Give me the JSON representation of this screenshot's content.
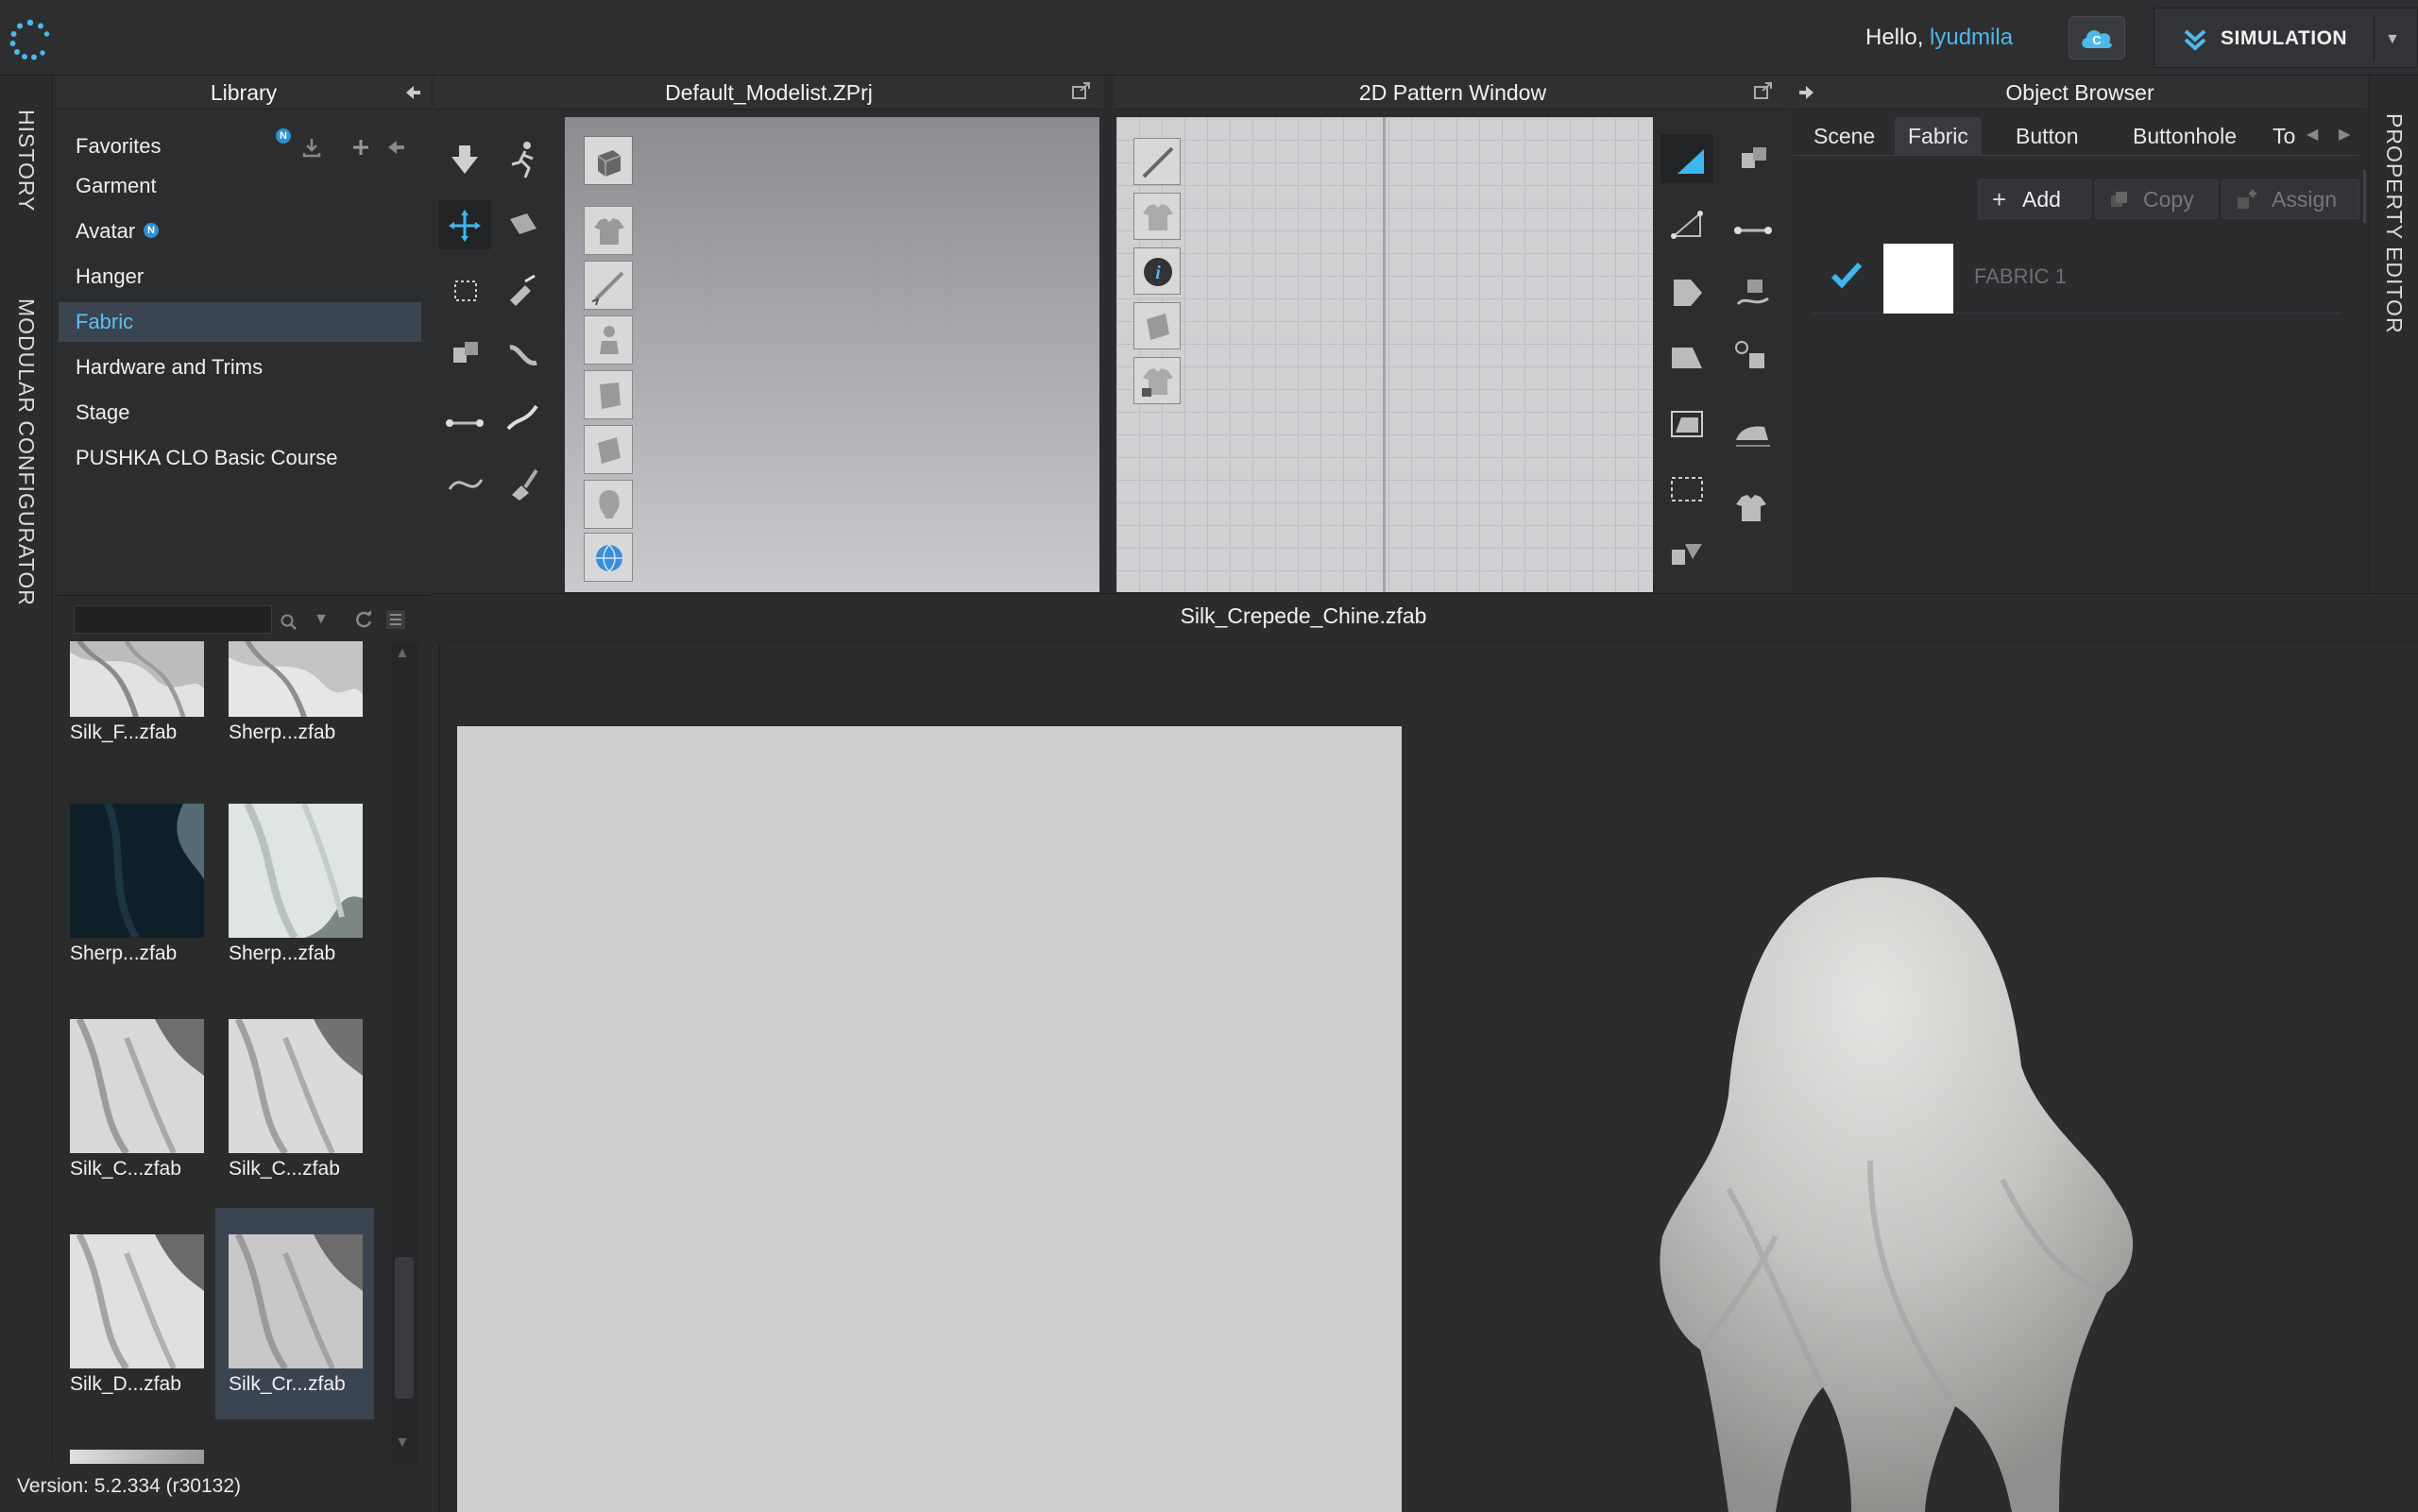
{
  "topbar": {
    "greeting": "Hello, ",
    "username": "lyudmila",
    "mode_label": "SIMULATION"
  },
  "side_tabs": {
    "left": [
      "HISTORY",
      "MODULAR CONFIGURATOR"
    ],
    "right": [
      "PROPERTY EDITOR"
    ]
  },
  "library": {
    "title": "Library",
    "items": [
      "Favorites",
      "Garment",
      "Avatar",
      "Hanger",
      "Fabric",
      "Hardware and Trims",
      "Stage",
      "PUSHKA CLO Basic Course"
    ],
    "selected": "Fabric",
    "new_badge": "N"
  },
  "browser": {
    "search_value": "",
    "thumbs": [
      {
        "label": "Silk_F...zfab",
        "tone": "light"
      },
      {
        "label": "Sherp...zfab",
        "tone": "light"
      },
      {
        "label": "Sherp...zfab",
        "tone": "dark"
      },
      {
        "label": "Sherp...zfab",
        "tone": "pale"
      },
      {
        "label": "Silk_C...zfab",
        "tone": "light"
      },
      {
        "label": "Silk_C...zfab",
        "tone": "light"
      },
      {
        "label": "Silk_D...zfab",
        "tone": "light"
      },
      {
        "label": "Silk_Cr...zfab",
        "tone": "light"
      }
    ]
  },
  "viewport3d": {
    "title": "Default_Modelist.ZPrj"
  },
  "pattern2d": {
    "title": "2D Pattern Window"
  },
  "object_browser": {
    "title": "Object Browser",
    "tabs": [
      "Scene",
      "Fabric",
      "Button",
      "Buttonhole",
      "To"
    ],
    "active_tab": "Fabric",
    "add_label": "Add",
    "copy_label": "Copy",
    "assign_label": "Assign",
    "fabric_item": "FABRIC 1"
  },
  "viewer": {
    "title": "Silk_Crepede_Chine.zfab"
  },
  "status": {
    "version": "Version: 5.2.334 (r30132)"
  },
  "colors": {
    "accent": "#4fb8e8",
    "selected_row": "#3b4451",
    "panel": "#2b2c2e"
  }
}
